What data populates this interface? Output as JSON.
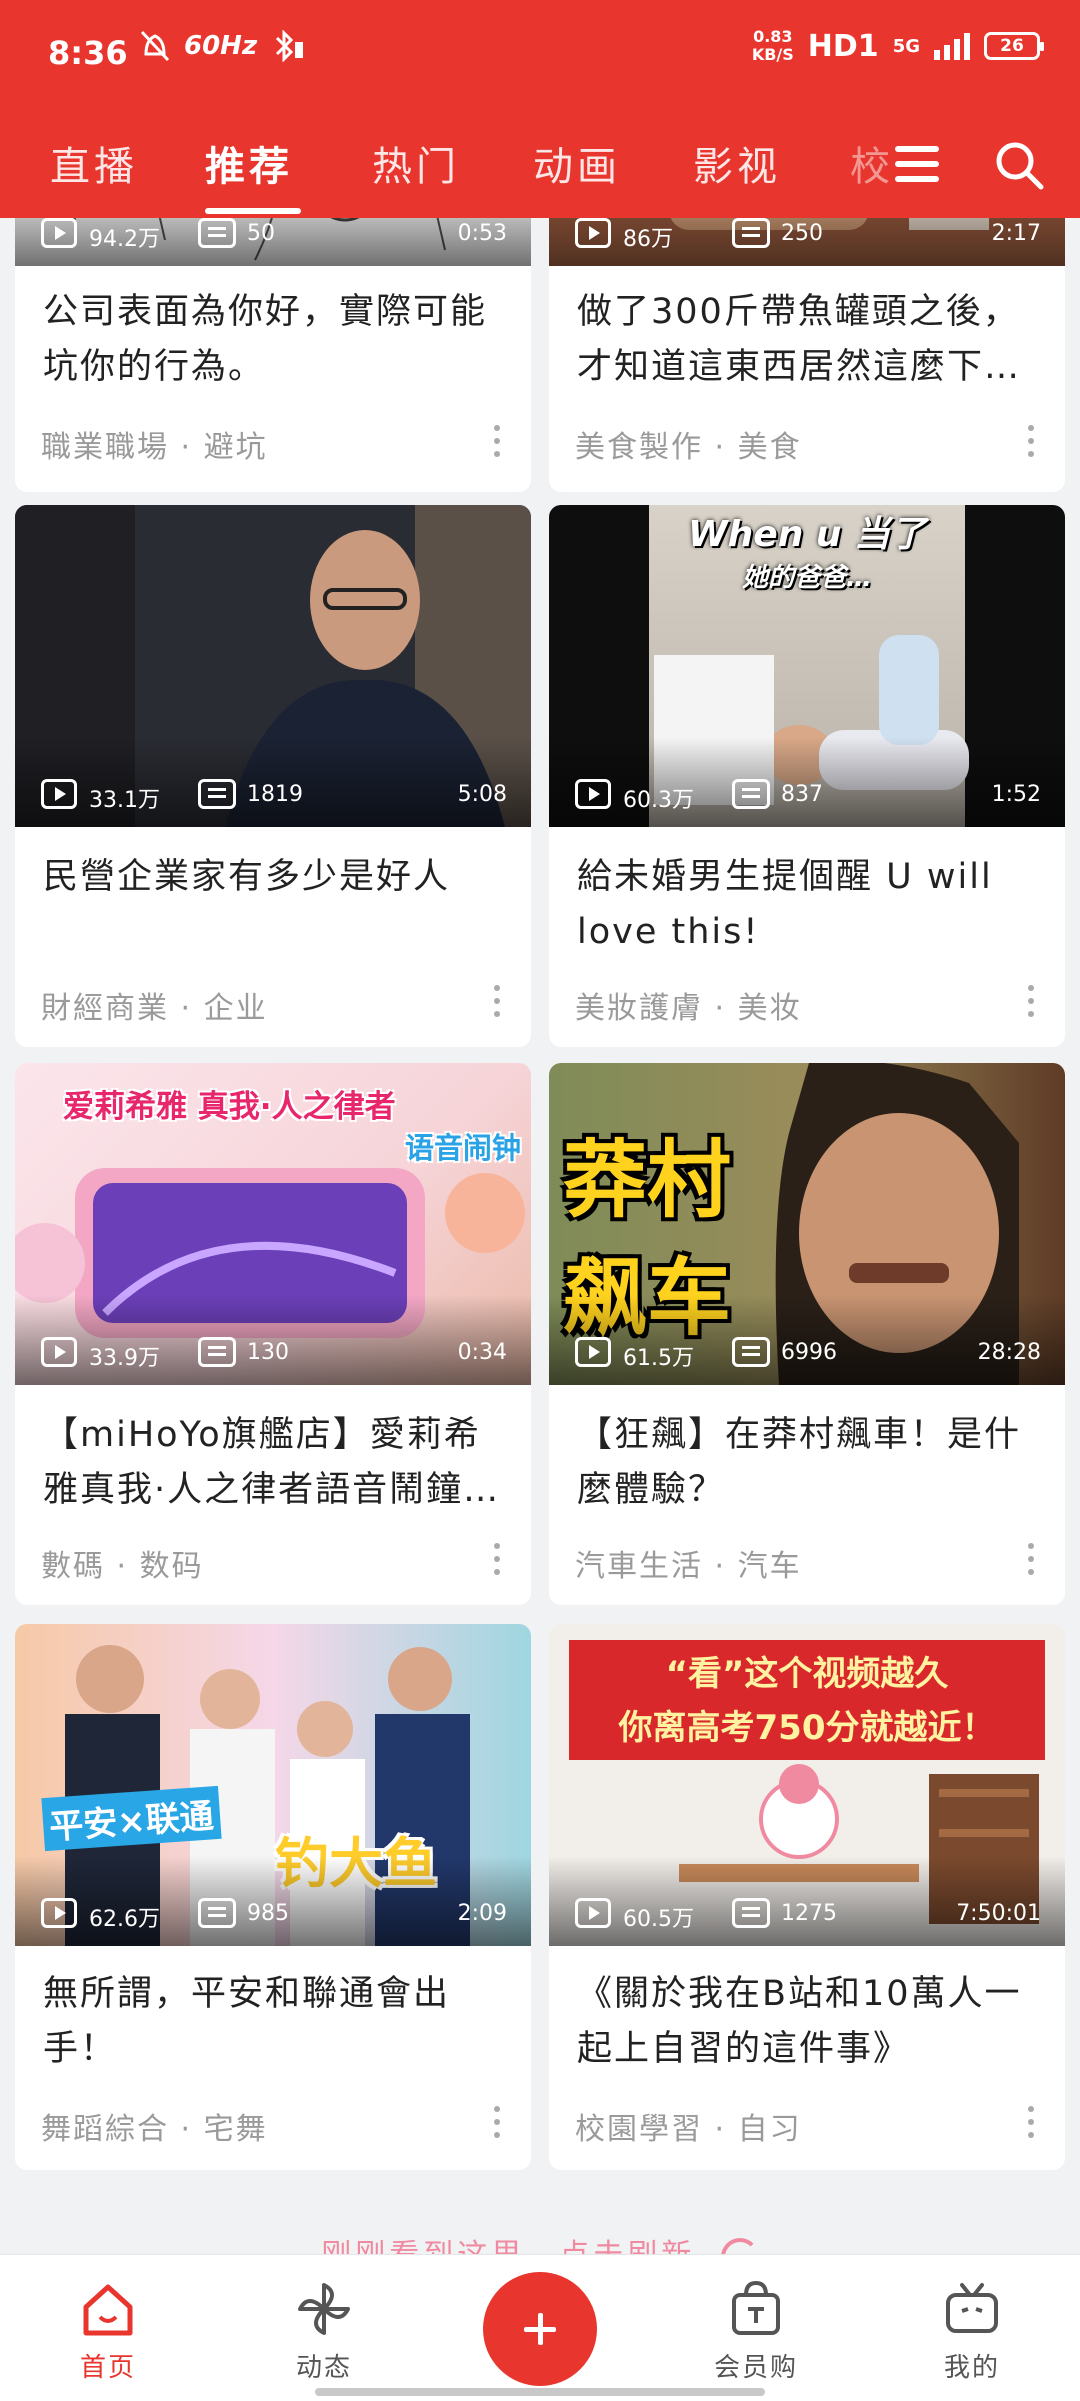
{
  "status_bar": {
    "time": "8:36",
    "refresh_rate": "60Hz",
    "net_speed_value": "0.83",
    "net_speed_unit": "KB/S",
    "hd": "HD1",
    "network": "5G",
    "battery": "26"
  },
  "tabs": [
    {
      "label": "直播"
    },
    {
      "label": "推荐"
    },
    {
      "label": "热门"
    },
    {
      "label": "动画"
    },
    {
      "label": "影视"
    },
    {
      "label": "校"
    }
  ],
  "active_tab": "推荐",
  "cards": [
    {
      "views": "94.2万",
      "danmaku": "50",
      "duration": "0:53",
      "title": "公司表面為你好，實際可能坑你的行為。",
      "category": "職業職場",
      "tag": "避坑"
    },
    {
      "views": "86万",
      "danmaku": "250",
      "duration": "2:17",
      "title": "做了300斤帶魚罐頭之後，才知道這東西居然這麼下…",
      "category": "美食製作",
      "tag": "美食"
    },
    {
      "views": "33.1万",
      "danmaku": "1819",
      "duration": "5:08",
      "title": "民營企業家有多少是好人",
      "category": "財經商業",
      "tag": "企业"
    },
    {
      "views": "60.3万",
      "danmaku": "837",
      "duration": "1:52",
      "title": "給未婚男生提個醒 U will love this!",
      "category": "美妝護膚",
      "tag": "美妆",
      "thumb_text": [
        "When u 当了",
        "她的爸爸…"
      ]
    },
    {
      "views": "33.9万",
      "danmaku": "130",
      "duration": "0:34",
      "title": "【miHoYo旗艦店】愛莉希雅真我·人之律者語音鬧鐘…",
      "category": "數碼",
      "tag": "数码",
      "thumb_text": [
        "爱莉希雅 真我·人之律者",
        "语音闹钟"
      ]
    },
    {
      "views": "61.5万",
      "danmaku": "6996",
      "duration": "28:28",
      "title": "【狂飆】在莽村飆車！是什麼體驗？",
      "category": "汽車生活",
      "tag": "汽车",
      "thumb_text": [
        "莽村",
        "飙车"
      ]
    },
    {
      "views": "62.6万",
      "danmaku": "985",
      "duration": "2:09",
      "title": "無所謂，平安和聯通會出手！",
      "category": "舞蹈綜合",
      "tag": "宅舞",
      "thumb_text": [
        "平安×联通",
        "钓大鱼"
      ]
    },
    {
      "views": "60.5万",
      "danmaku": "1275",
      "duration": "7:50:01",
      "title": "《關於我在B站和10萬人一起上自習的這件事》",
      "category": "校園學習",
      "tag": "自习",
      "thumb_text": [
        "“看”这个视频越久",
        "你离高考750分就越近！"
      ]
    }
  ],
  "refresh_hint": "刚刚看到这里，点击刷新",
  "bottom_nav": [
    {
      "label": "首页",
      "icon": "home-icon"
    },
    {
      "label": "动态",
      "icon": "pinwheel-icon"
    },
    {
      "label": "",
      "icon": "plus-icon"
    },
    {
      "label": "会员购",
      "icon": "shopping-bag-icon"
    },
    {
      "label": "我的",
      "icon": "tv-icon"
    }
  ],
  "colors": {
    "brand": "#e8362e",
    "background": "#f1f2f3",
    "refresh_hint": "#f08aa1"
  }
}
